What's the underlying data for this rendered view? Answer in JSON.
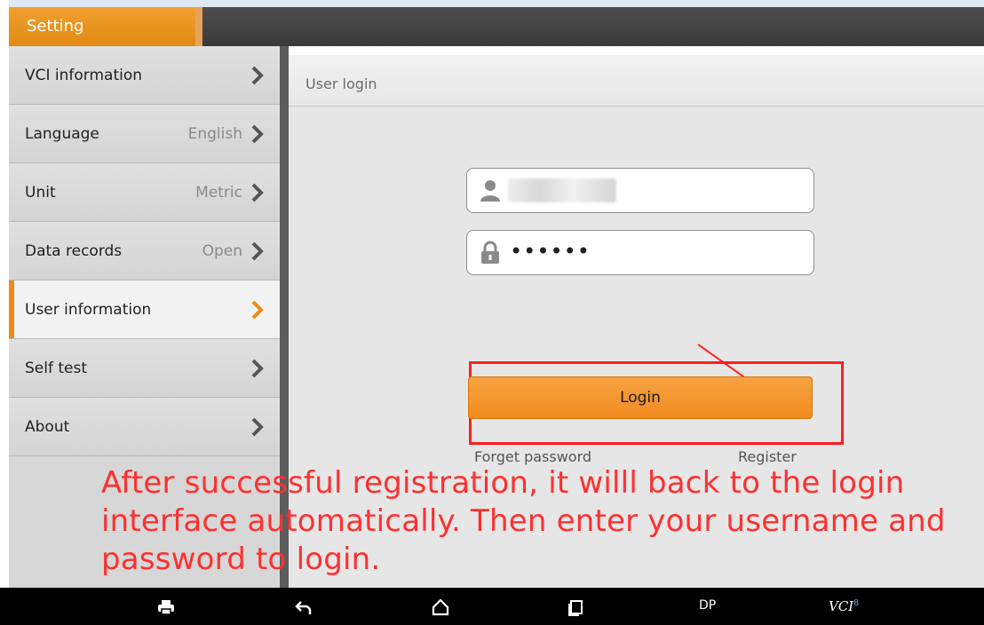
{
  "window": {
    "title": "Setting"
  },
  "sidebar": {
    "items": [
      {
        "label": "VCI information",
        "value": ""
      },
      {
        "label": "Language",
        "value": "English"
      },
      {
        "label": "Unit",
        "value": "Metric"
      },
      {
        "label": "Data records",
        "value": "Open"
      },
      {
        "label": "User information",
        "value": "",
        "active": true
      },
      {
        "label": "Self test",
        "value": ""
      },
      {
        "label": "About",
        "value": ""
      }
    ]
  },
  "panel": {
    "title": "User login",
    "password_mask": "••••••",
    "login_label": "Login",
    "forget_label": "Forget password",
    "register_label": "Register"
  },
  "annotation": {
    "text": "After successful registration, it willl back to the login interface automatically. Then enter your username and password to login."
  },
  "nav": {
    "dp_label": "DP",
    "vci_label": "VCI",
    "vci_badge": "8"
  },
  "colors": {
    "accent": "#f0901f",
    "annotation": "#ff3030",
    "topbar": "#404040"
  }
}
